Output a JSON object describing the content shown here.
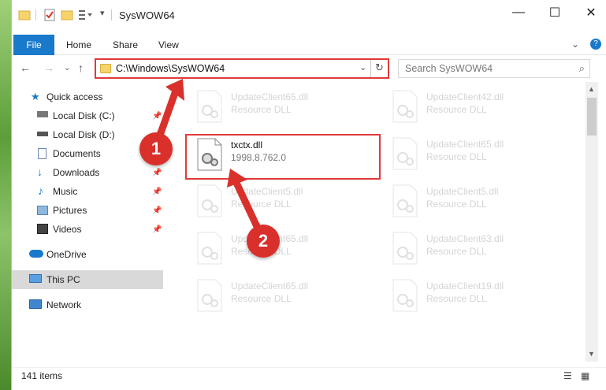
{
  "window": {
    "title": "SysWOW64"
  },
  "ribbon": {
    "tabs": [
      "File",
      "Home",
      "Share",
      "View"
    ]
  },
  "address": {
    "path": "C:\\Windows\\SysWOW64"
  },
  "search": {
    "placeholder": "Search SysWOW64"
  },
  "sidebar": {
    "items": [
      {
        "label": "Quick access",
        "icon": "star-icon",
        "pinned": false
      },
      {
        "label": "Local Disk (C:)",
        "icon": "drive-icon",
        "pinned": true
      },
      {
        "label": "Local Disk (D:)",
        "icon": "drive-icon",
        "pinned": true
      },
      {
        "label": "Documents",
        "icon": "document-icon",
        "pinned": true
      },
      {
        "label": "Downloads",
        "icon": "download-icon",
        "pinned": true
      },
      {
        "label": "Music",
        "icon": "music-icon",
        "pinned": true
      },
      {
        "label": "Pictures",
        "icon": "picture-icon",
        "pinned": true
      },
      {
        "label": "Videos",
        "icon": "video-icon",
        "pinned": true
      },
      {
        "label": "OneDrive",
        "icon": "cloud-icon",
        "pinned": false
      },
      {
        "label": "This PC",
        "icon": "computer-icon",
        "pinned": false,
        "selected": true
      },
      {
        "label": "Network",
        "icon": "network-icon",
        "pinned": false
      }
    ]
  },
  "files": {
    "left": [
      {
        "name": "UpdateClient65.dll",
        "desc": "Resource DLL"
      },
      {
        "name": "txctx.dll",
        "desc": "1998.8.762.0"
      },
      {
        "name": "UpdateClient5.dll",
        "desc": "Resource DLL"
      },
      {
        "name": "UpdateClient65.dll",
        "desc": "Resource DLL"
      },
      {
        "name": "UpdateClient65.dll",
        "desc": "Resource DLL"
      }
    ],
    "right": [
      {
        "name": "UpdateClient42.dll",
        "desc": "Resource DLL"
      },
      {
        "name": "UpdateClient65.dll",
        "desc": "Resource DLL"
      },
      {
        "name": "UpdateClient5.dll",
        "desc": "Resource DLL"
      },
      {
        "name": "UpdateClient63.dll",
        "desc": "Resource DLL"
      },
      {
        "name": "UpdateClient19.dll",
        "desc": "Resource DLL"
      }
    ]
  },
  "status": {
    "item_count": "141 items"
  },
  "annotations": {
    "step1": "1",
    "step2": "2"
  },
  "colors": {
    "accent": "#1979ca",
    "highlight": "#e03a3a",
    "callout": "#d9302b"
  }
}
